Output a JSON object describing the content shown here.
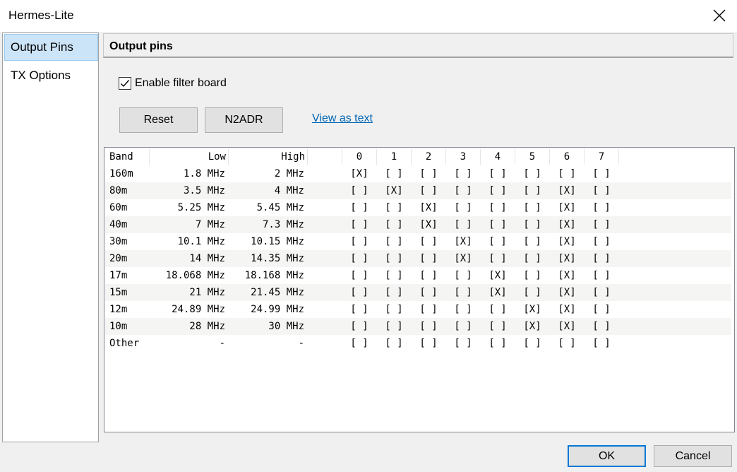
{
  "window": {
    "title": "Hermes-Lite"
  },
  "sidebar": {
    "items": [
      {
        "label": "Output Pins",
        "selected": true
      },
      {
        "label": "TX Options",
        "selected": false
      }
    ]
  },
  "panel": {
    "header": "Output pins",
    "enable_filter_label": "Enable filter board",
    "enable_filter_checked": true,
    "reset_label": "Reset",
    "n2adr_label": "N2ADR",
    "view_text_link": "View as text"
  },
  "table": {
    "headers": {
      "band": "Band",
      "low": "Low",
      "high": "High",
      "pins": [
        "0",
        "1",
        "2",
        "3",
        "4",
        "5",
        "6",
        "7"
      ]
    },
    "rows": [
      {
        "band": "160m",
        "low": "1.8 MHz",
        "high": "2 MHz",
        "pins": [
          "[X]",
          "[ ]",
          "[ ]",
          "[ ]",
          "[ ]",
          "[ ]",
          "[ ]",
          "[ ]"
        ]
      },
      {
        "band": "80m",
        "low": "3.5 MHz",
        "high": "4 MHz",
        "pins": [
          "[ ]",
          "[X]",
          "[ ]",
          "[ ]",
          "[ ]",
          "[ ]",
          "[X]",
          "[ ]"
        ]
      },
      {
        "band": "60m",
        "low": "5.25 MHz",
        "high": "5.45 MHz",
        "pins": [
          "[ ]",
          "[ ]",
          "[X]",
          "[ ]",
          "[ ]",
          "[ ]",
          "[X]",
          "[ ]"
        ]
      },
      {
        "band": "40m",
        "low": "7 MHz",
        "high": "7.3 MHz",
        "pins": [
          "[ ]",
          "[ ]",
          "[X]",
          "[ ]",
          "[ ]",
          "[ ]",
          "[X]",
          "[ ]"
        ]
      },
      {
        "band": "30m",
        "low": "10.1 MHz",
        "high": "10.15 MHz",
        "pins": [
          "[ ]",
          "[ ]",
          "[ ]",
          "[X]",
          "[ ]",
          "[ ]",
          "[X]",
          "[ ]"
        ]
      },
      {
        "band": "20m",
        "low": "14 MHz",
        "high": "14.35 MHz",
        "pins": [
          "[ ]",
          "[ ]",
          "[ ]",
          "[X]",
          "[ ]",
          "[ ]",
          "[X]",
          "[ ]"
        ]
      },
      {
        "band": "17m",
        "low": "18.068 MHz",
        "high": "18.168 MHz",
        "pins": [
          "[ ]",
          "[ ]",
          "[ ]",
          "[ ]",
          "[X]",
          "[ ]",
          "[X]",
          "[ ]"
        ]
      },
      {
        "band": "15m",
        "low": "21 MHz",
        "high": "21.45 MHz",
        "pins": [
          "[ ]",
          "[ ]",
          "[ ]",
          "[ ]",
          "[X]",
          "[ ]",
          "[X]",
          "[ ]"
        ]
      },
      {
        "band": "12m",
        "low": "24.89 MHz",
        "high": "24.99 MHz",
        "pins": [
          "[ ]",
          "[ ]",
          "[ ]",
          "[ ]",
          "[ ]",
          "[X]",
          "[X]",
          "[ ]"
        ]
      },
      {
        "band": "10m",
        "low": "28 MHz",
        "high": "30 MHz",
        "pins": [
          "[ ]",
          "[ ]",
          "[ ]",
          "[ ]",
          "[ ]",
          "[X]",
          "[X]",
          "[ ]"
        ]
      },
      {
        "band": "Other",
        "low": "-",
        "high": "-",
        "pins": [
          "[ ]",
          "[ ]",
          "[ ]",
          "[ ]",
          "[ ]",
          "[ ]",
          "[ ]",
          "[ ]"
        ]
      }
    ]
  },
  "footer": {
    "ok_label": "OK",
    "cancel_label": "Cancel"
  }
}
